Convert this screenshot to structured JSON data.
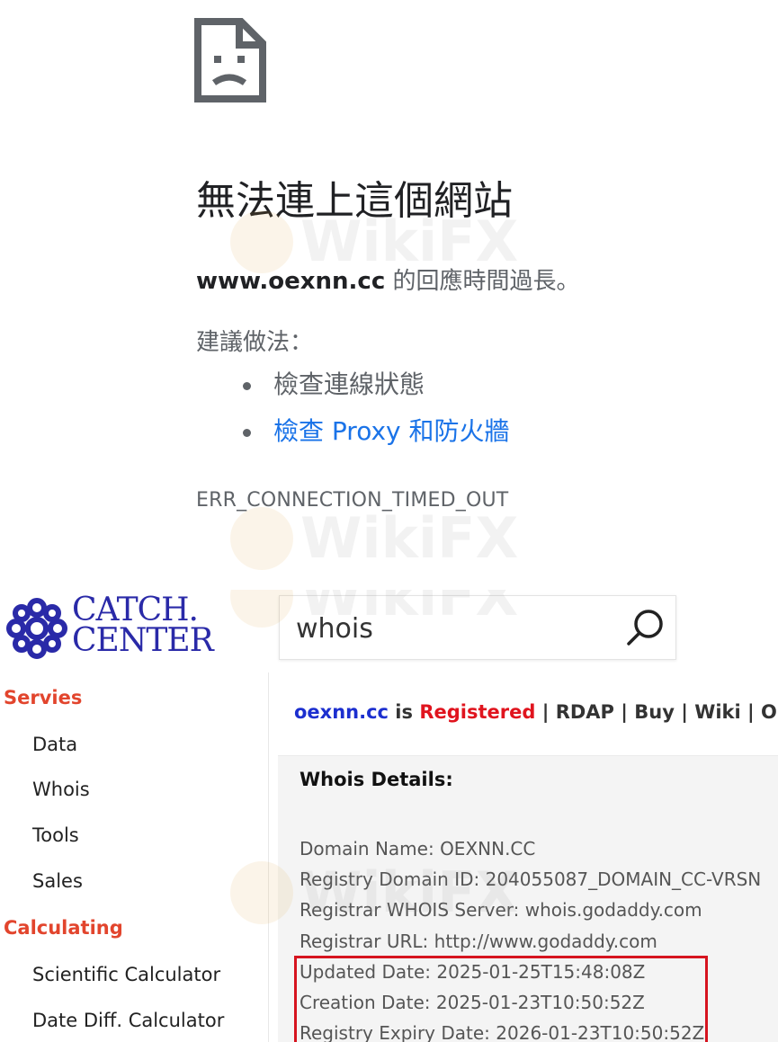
{
  "error_page": {
    "icon": "sad-page-icon",
    "title": "無法連上這個網站",
    "domain": "www.oexnn.cc",
    "message_suffix": " 的回應時間過長。",
    "suggestion_heading": "建議做法：",
    "suggestions": [
      {
        "label": "檢查連線狀態",
        "link": false
      },
      {
        "label": "檢查 Proxy 和防火牆",
        "link": true
      }
    ],
    "error_code": "ERR_CONNECTION_TIMED_OUT",
    "link_color": "#1a73e8"
  },
  "watermark": {
    "text": "WikiFX"
  },
  "site": {
    "logo": {
      "line1": "CATCH.",
      "line2": "CENTER",
      "color": "#2a2aa8"
    },
    "search": {
      "value": "whois",
      "icon": "search-icon"
    },
    "sidebar": {
      "sections": [
        {
          "title": "Servies",
          "items": [
            "Data",
            "Whois",
            "Tools",
            "Sales"
          ]
        },
        {
          "title": "Calculating",
          "items": [
            "Scientific Calculator",
            "Date Diff. Calculator"
          ]
        }
      ],
      "section_color": "#e2452d"
    },
    "status_line": {
      "domain": "oexnn.cc",
      "is": " is ",
      "status": "Registered",
      "separator": " | ",
      "links": [
        "RDAP",
        "Buy",
        "Wiki",
        "Open"
      ],
      "domain_color": "#1c2fcf",
      "status_color": "#e0141e"
    },
    "whois": {
      "title": "Whois Details:",
      "lines": [
        "Domain Name: OEXNN.CC",
        "Registry Domain ID: 204055087_DOMAIN_CC-VRSN",
        "Registrar WHOIS Server: whois.godaddy.com",
        "Registrar URL: http://www.godaddy.com",
        "Updated Date: 2025-01-25T15:48:08Z",
        "Creation Date: 2025-01-23T10:50:52Z",
        "Registry Expiry Date: 2026-01-23T10:50:52Z"
      ],
      "highlight_color": "#d6141f"
    }
  }
}
